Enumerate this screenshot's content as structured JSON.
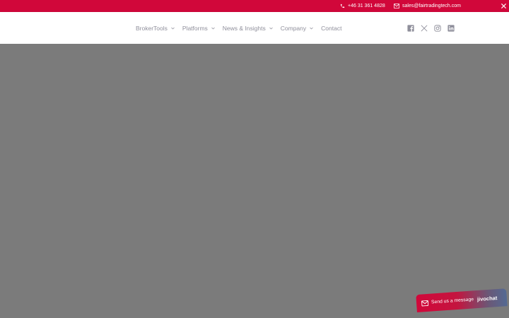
{
  "topbar": {
    "phone": "+46 31 361 4828",
    "email": "sales@fairtradingtech.com",
    "background": "#d1073a"
  },
  "nav": {
    "items": [
      {
        "label": "BrokerTools",
        "has_dropdown": true
      },
      {
        "label": "Platforms",
        "has_dropdown": true
      },
      {
        "label": "News & Insights",
        "has_dropdown": true
      },
      {
        "label": "Company",
        "has_dropdown": true
      },
      {
        "label": "Contact",
        "has_dropdown": false
      }
    ]
  },
  "social": [
    "facebook-icon",
    "x-icon",
    "instagram-icon",
    "linkedin-icon"
  ],
  "chat": {
    "label": "Send us a message",
    "brand": "jivochat"
  }
}
